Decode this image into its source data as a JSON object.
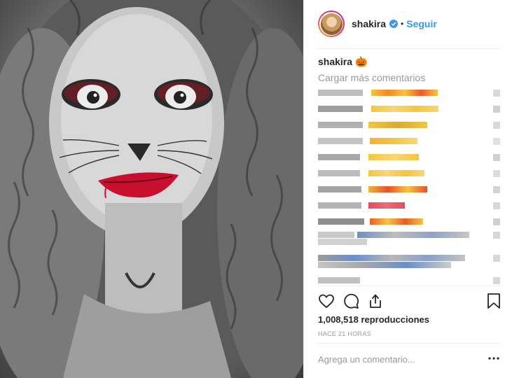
{
  "header": {
    "username": "shakira",
    "dot": "•",
    "follow_label": "Seguir",
    "verified_color": "#3897f0"
  },
  "caption": {
    "username": "shakira",
    "emoji": "🎃"
  },
  "load_more_label": "Cargar más comentarios",
  "stats": {
    "plays": "1,008,518 reproducciones",
    "time_ago": "HACE 21 HORAS"
  },
  "comment_input": {
    "placeholder": "Agrega un comentario..."
  },
  "icons": [
    "heart-icon",
    "comment-icon",
    "share-icon",
    "bookmark-icon",
    "more-options-icon"
  ],
  "colors": {
    "accent": "#3897f0",
    "text": "#262626",
    "muted": "#999999"
  }
}
